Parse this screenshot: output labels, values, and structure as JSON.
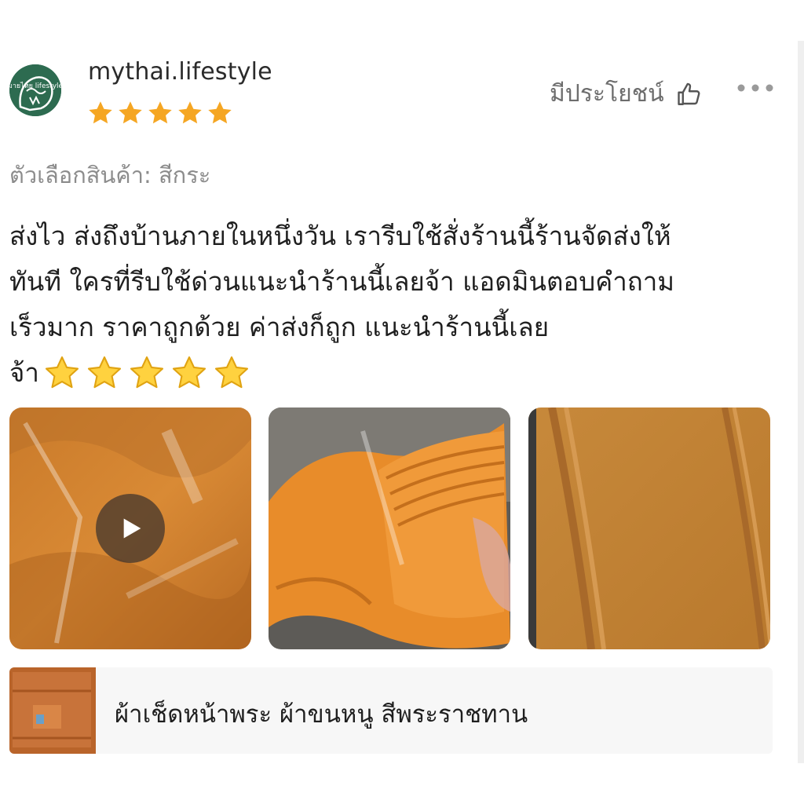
{
  "review": {
    "username": "mythai.lifestyle",
    "avatar_text": "มายไทย lifestyle",
    "rating": 5,
    "helpful_label": "มีประโยชน์",
    "variation": "ตัวเลือกสินค้า: สีกระ",
    "text_lines": [
      "ส่งไว ส่งถึงบ้านภายในหนึ่งวัน เรารีบใช้สั่งร้านนี้ร้านจัดส่งให้",
      "ทันที ใครที่รีบใช้ด่วนแนะนำร้านนี้เลยจ้า แอดมินตอบคำถาม",
      "เร็วมาก ราคาถูกด้วย ค่าส่งก็ถูก แนะนำร้านนี้เลย",
      "จ้า"
    ],
    "emoji_star_count": 5,
    "media": [
      {
        "type": "video",
        "icon": "play-icon"
      },
      {
        "type": "photo"
      },
      {
        "type": "photo"
      }
    ]
  },
  "product": {
    "name": "ผ้าเช็ดหน้าพระ ผ้าขนหนู สีพระราชทาน"
  },
  "colors": {
    "star": "#f5a623",
    "avatar_bg": "#2d6b50",
    "towel": "#d98a2e",
    "muted_text": "#8c8c8c",
    "card_bg": "#f7f7f7"
  },
  "icons": {
    "thumb": "thumbs-up-icon",
    "more": "more-options-icon",
    "star": "star-icon"
  }
}
